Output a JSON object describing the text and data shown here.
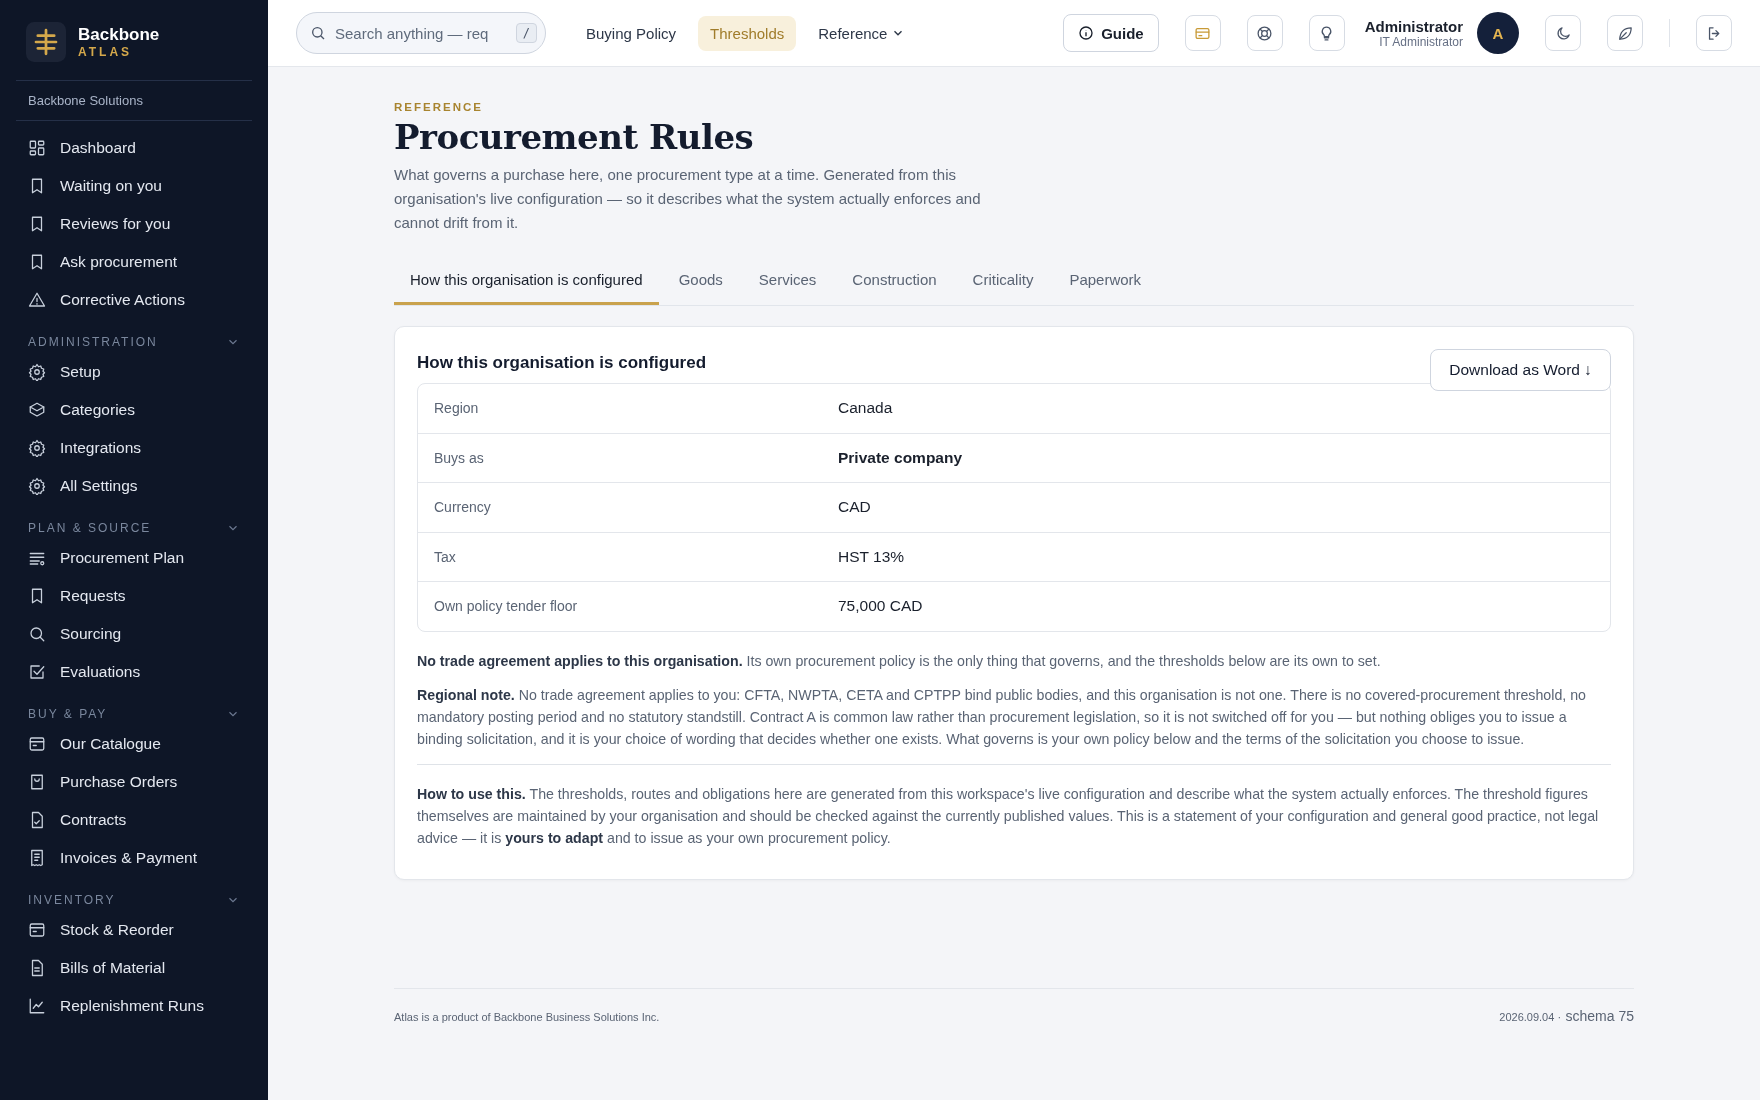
{
  "brand": {
    "name": "Backbone",
    "sub": "ATLAS",
    "org": "Backbone Solutions"
  },
  "sidebar": {
    "items": [
      {
        "label": "Dashboard",
        "kind": "grid"
      },
      {
        "label": "Waiting on you",
        "kind": "bookmark"
      },
      {
        "label": "Reviews for you",
        "kind": "bookmark"
      },
      {
        "label": "Ask procurement",
        "kind": "bookmark"
      },
      {
        "label": "Corrective Actions",
        "kind": "alert"
      }
    ],
    "sections": [
      {
        "title": "ADMINISTRATION",
        "expanded": true,
        "items": [
          {
            "label": "Setup",
            "kind": "gear"
          },
          {
            "label": "Categories",
            "kind": "cube"
          },
          {
            "label": "Integrations",
            "kind": "gear"
          },
          {
            "label": "All Settings",
            "kind": "gear"
          }
        ]
      },
      {
        "title": "PLAN & SOURCE",
        "expanded": true,
        "items": [
          {
            "label": "Procurement Plan",
            "kind": "list"
          },
          {
            "label": "Requests",
            "kind": "bookmark"
          },
          {
            "label": "Sourcing",
            "kind": "search"
          },
          {
            "label": "Evaluations",
            "kind": "check"
          }
        ]
      },
      {
        "title": "BUY & PAY",
        "expanded": true,
        "items": [
          {
            "label": "Our Catalogue",
            "kind": "card"
          },
          {
            "label": "Purchase Orders",
            "kind": "bag"
          },
          {
            "label": "Contracts",
            "kind": "filecheck"
          },
          {
            "label": "Invoices & Payment",
            "kind": "receipt"
          }
        ]
      },
      {
        "title": "INVENTORY",
        "expanded": true,
        "items": [
          {
            "label": "Stock & Reorder",
            "kind": "card"
          },
          {
            "label": "Bills of Material",
            "kind": "file"
          },
          {
            "label": "Replenishment Runs",
            "kind": "chart"
          }
        ]
      }
    ]
  },
  "topbar": {
    "search": {
      "placeholder": "Search anything — req",
      "shortcut": "/"
    },
    "nav": [
      {
        "label": "Buying Policy",
        "selected": false,
        "dropdown": false
      },
      {
        "label": "Thresholds",
        "selected": true,
        "dropdown": false
      },
      {
        "label": "Reference",
        "selected": false,
        "dropdown": true
      }
    ],
    "guide": "Guide",
    "user": {
      "name": "Administrator",
      "role": "IT Administrator",
      "initial": "A"
    }
  },
  "page": {
    "eyebrow": "REFERENCE",
    "title": "Procurement Rules",
    "intro": "What governs a purchase here, one procurement type at a time. Generated from this organisation's live configuration — so it describes what the system actually enforces and cannot drift from it.",
    "tabs": [
      {
        "label": "How this organisation is configured",
        "selected": true
      },
      {
        "label": "Goods",
        "selected": false
      },
      {
        "label": "Services",
        "selected": false
      },
      {
        "label": "Construction",
        "selected": false
      },
      {
        "label": "Criticality",
        "selected": false
      },
      {
        "label": "Paperwork",
        "selected": false
      }
    ]
  },
  "card": {
    "title": "How this organisation is configured",
    "download": "Download as Word ↓",
    "rows": [
      {
        "label": "Region",
        "value": "Canada",
        "strong": false
      },
      {
        "label": "Buys as",
        "value": "Private company",
        "strong": true
      },
      {
        "label": "Currency",
        "value": "CAD",
        "strong": false
      },
      {
        "label": "Tax",
        "value": "HST 13%",
        "strong": false
      },
      {
        "label": "Own policy tender floor",
        "value": "75,000 CAD",
        "strong": false
      }
    ],
    "notes": [
      "**No trade agreement applies to this organisation.** Its own procurement policy is the only thing that governs, and the thresholds below are its own to set.",
      "**Regional note.** No trade agreement applies to you: CFTA, NWPTA, CETA and CPTPP bind public bodies, and this organisation is not one. There is no covered-procurement threshold, no mandatory posting period and no statutory standstill. Contract A is common law rather than procurement legislation, so it is not switched off for you — but nothing obliges you to issue a binding solicitation, and it is your choice of wording that decides whether one exists. What governs is your own policy below and the terms of the solicitation you choose to issue."
    ],
    "usage": "**How to use this.** The thresholds, routes and obligations here are generated from this workspace's live configuration and describe what the system actually enforces. The threshold figures themselves are maintained by your organisation and should be checked against the currently published values. This is a statement of your configuration and general good practice, not legal advice — it is **yours to adapt** and to issue as your own procurement policy."
  },
  "footer": {
    "left": "Atlas is a product of Backbone Business Solutions Inc.",
    "date": "2026.09.04 ·",
    "schema": "schema 75"
  }
}
